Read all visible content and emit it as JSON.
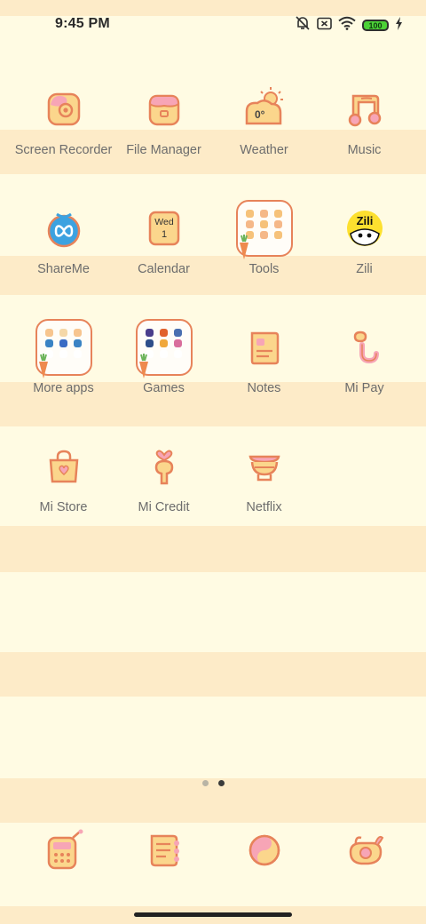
{
  "status_bar": {
    "time": "9:45 PM",
    "battery": "100",
    "icons": [
      "bell-muted-icon",
      "close-box-icon",
      "wifi-icon",
      "battery-icon",
      "charging-bolt-icon"
    ]
  },
  "apps": [
    {
      "label": "Screen Recorder",
      "icon": "screen-recorder-icon"
    },
    {
      "label": "File Manager",
      "icon": "file-manager-icon"
    },
    {
      "label": "Weather",
      "icon": "weather-icon",
      "temp": "0°"
    },
    {
      "label": "Music",
      "icon": "music-icon"
    },
    {
      "label": "ShareMe",
      "icon": "shareme-icon"
    },
    {
      "label": "Calendar",
      "icon": "calendar-icon",
      "day": "Wed",
      "date": "1"
    },
    {
      "label": "Tools",
      "icon": "tools-folder-icon"
    },
    {
      "label": "Zili",
      "icon": "zili-icon",
      "logo_text": "Zili"
    },
    {
      "label": "More apps",
      "icon": "more-apps-folder-icon"
    },
    {
      "label": "Games",
      "icon": "games-folder-icon"
    },
    {
      "label": "Notes",
      "icon": "notes-icon"
    },
    {
      "label": "Mi Pay",
      "icon": "mi-pay-icon"
    },
    {
      "label": "Mi Store",
      "icon": "mi-store-icon"
    },
    {
      "label": "Mi Credit",
      "icon": "mi-credit-icon"
    },
    {
      "label": "Netflix",
      "icon": "netflix-icon"
    }
  ],
  "page_indicator": {
    "count": 2,
    "active": 2
  },
  "dock": [
    {
      "icon": "phone-icon"
    },
    {
      "icon": "messages-icon"
    },
    {
      "icon": "browser-icon"
    },
    {
      "icon": "camera-icon"
    }
  ],
  "colors": {
    "background": "#fffbe3",
    "stripe": "#fdebc8",
    "icon_outline": "#e7835a",
    "icon_fill": "#fbd68c",
    "pink": "#f7a5b6"
  }
}
